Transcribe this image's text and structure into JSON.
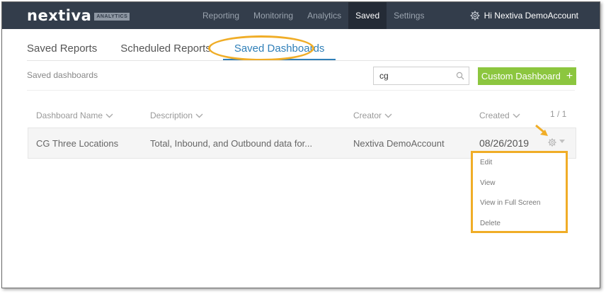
{
  "header": {
    "logo_text": "nextiva",
    "logo_badge": "ANALYTICS",
    "nav": [
      "Reporting",
      "Monitoring",
      "Analytics",
      "Saved",
      "Settings"
    ],
    "active_nav": "Saved",
    "greeting": "Hi Nextiva DemoAccount"
  },
  "tabs": [
    "Saved Reports",
    "Scheduled Reports",
    "Saved Dashboards"
  ],
  "active_tab": "Saved Dashboards",
  "toolbar": {
    "section_label": "Saved dashboards",
    "search_value": "cg",
    "custom_button_label": "Custom Dashboard",
    "plus": "+"
  },
  "table": {
    "columns": [
      "Dashboard Name",
      "Description",
      "Creator",
      "Created"
    ],
    "pager": "1 / 1",
    "rows": [
      {
        "name": "CG Three Locations",
        "description": "Total, Inbound, and Outbound data for...",
        "creator": "Nextiva DemoAccount",
        "created": "08/26/2019"
      }
    ]
  },
  "row_menu": [
    "Edit",
    "View",
    "View in Full Screen",
    "Delete"
  ],
  "colors": {
    "nav_bg": "#333d4b",
    "accent_blue": "#2f7fb8",
    "button_green": "#8cc63f",
    "highlight_orange": "#f0ad27"
  },
  "icons": [
    "gear-icon",
    "search-icon",
    "chevron-down-icon",
    "plus-icon",
    "caret-down-icon",
    "arrow-annotation-icon"
  ]
}
